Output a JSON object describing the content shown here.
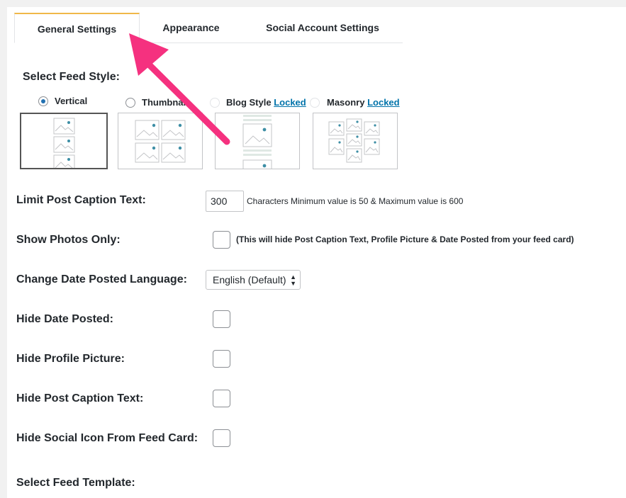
{
  "tabs": [
    {
      "label": "General Settings",
      "active": true
    },
    {
      "label": "Appearance",
      "active": false
    },
    {
      "label": "Social Account Settings",
      "active": false
    }
  ],
  "feed_style": {
    "heading": "Select Feed Style:",
    "options": [
      {
        "label": "Vertical",
        "checked": true,
        "locked": false
      },
      {
        "label": "Thumbnail",
        "checked": false,
        "locked": false
      },
      {
        "label": "Blog Style",
        "checked": false,
        "locked": true
      },
      {
        "label": "Masonry",
        "checked": false,
        "locked": true
      }
    ],
    "locked_text": "Locked"
  },
  "limit_caption": {
    "label": "Limit Post Caption Text:",
    "value": "300",
    "hint": "Characters Minimum value is 50 & Maximum value is 600"
  },
  "show_photos": {
    "label": "Show Photos Only:",
    "hint": "(This will hide Post Caption Text, Profile Picture & Date Posted from your feed card)"
  },
  "date_language": {
    "label": "Change Date Posted Language:",
    "selected": "English (Default)"
  },
  "hide_date": {
    "label": "Hide Date Posted:"
  },
  "hide_profile": {
    "label": "Hide Profile Picture:"
  },
  "hide_caption": {
    "label": "Hide Post Caption Text:"
  },
  "hide_social": {
    "label": "Hide Social Icon From Feed Card:"
  },
  "feed_template": {
    "heading": "Select Feed Template:"
  },
  "colors": {
    "accent": "#f0b849",
    "link": "#0073aa",
    "arrow": "#f5317f",
    "thumb_dot": "#3d8ea5"
  }
}
